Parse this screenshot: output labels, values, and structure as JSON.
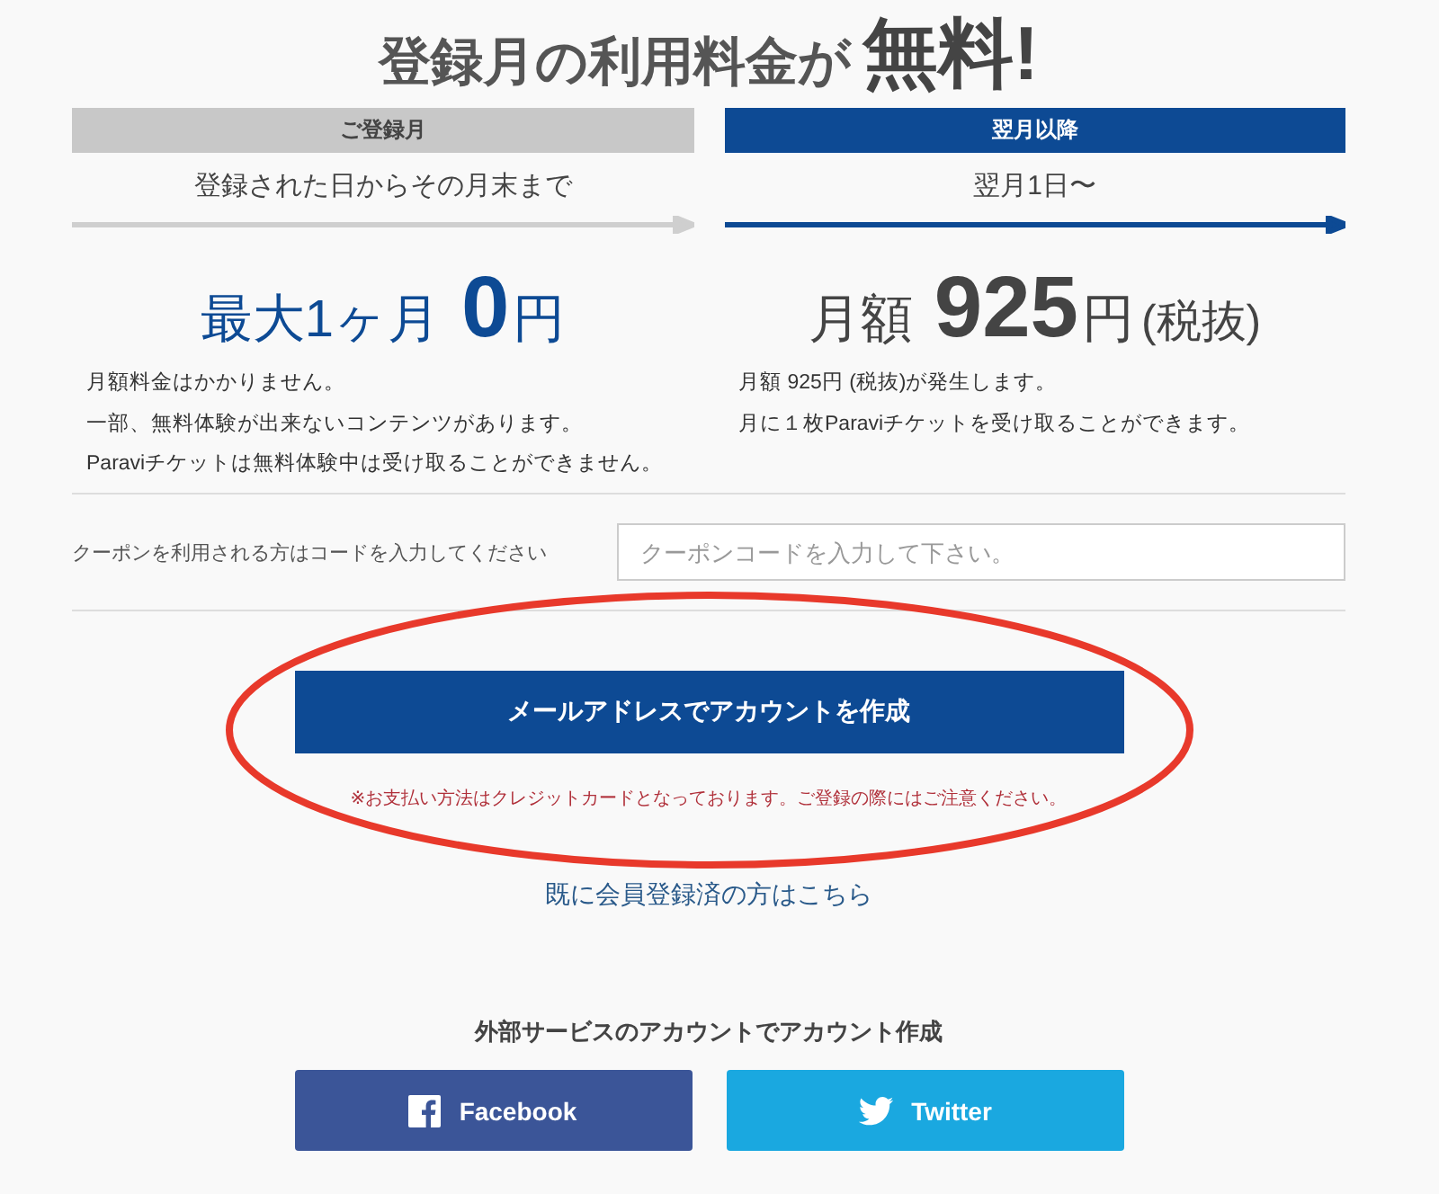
{
  "headline": {
    "text": "登録月の利用料金が",
    "emphasis": "無料!"
  },
  "plans": [
    {
      "kind": "free",
      "label": "ご登録月",
      "period": "登録された日からその月末まで",
      "price_prefix": "最大1ヶ月",
      "price": "0",
      "price_unit": "円",
      "notes": [
        "月額料金はかかりません。",
        "一部、無料体験が出来ないコンテンツがあります。",
        "Paraviチケットは無料体験中は受け取ることができません。"
      ]
    },
    {
      "kind": "paid",
      "label": "翌月以降",
      "period": "翌月1日〜",
      "price_prefix": "月額",
      "price": "925",
      "price_unit": "円",
      "price_suffix": "(税抜)",
      "notes": [
        "月額 925円 (税抜)が発生します。",
        "月に１枚Paraviチケットを受け取ることができます。"
      ]
    }
  ],
  "coupon": {
    "label": "クーポンを利用される方はコードを入力してください",
    "placeholder": "クーポンコードを入力して下さい。"
  },
  "create_button": "メールアドレスでアカウントを作成",
  "payment_note": "※お支払い方法はクレジットカードとなっております。ご登録の際にはご注意ください。",
  "annotation": {
    "kind": "ellipse"
  },
  "login_link": "既に会員登録済の方はこちら",
  "social": {
    "heading": "外部サービスのアカウントでアカウント作成",
    "buttons": [
      {
        "kind": "facebook",
        "label": "Facebook"
      },
      {
        "kind": "twitter",
        "label": "Twitter"
      }
    ]
  }
}
